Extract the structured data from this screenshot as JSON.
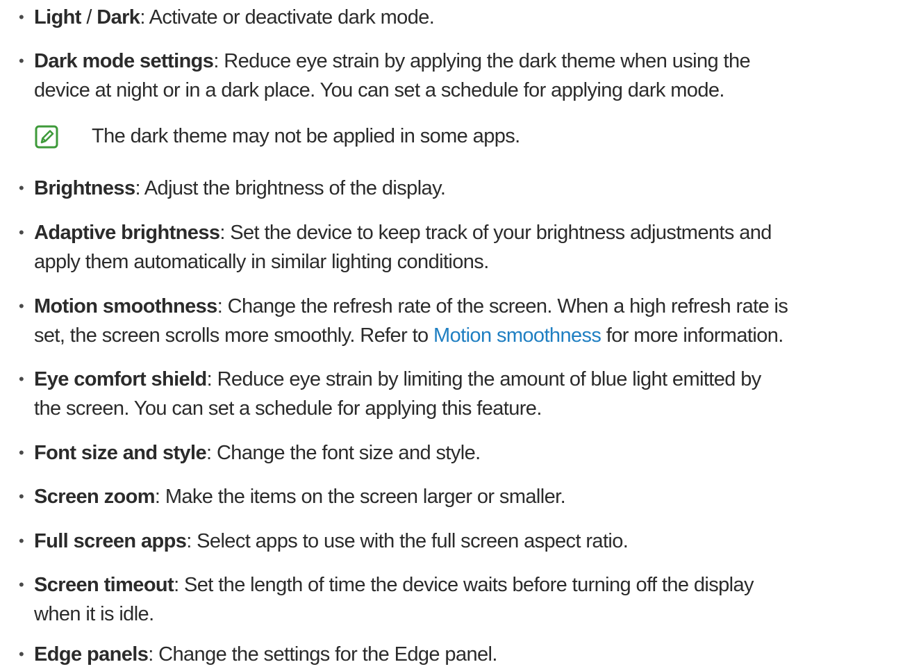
{
  "bullet_char": "•",
  "colors": {
    "text": "#2b2b2b",
    "link": "#1f7fc2",
    "note_icon": "#3e9a3a"
  },
  "items": [
    {
      "lines": [
        {
          "parts": [
            {
              "t": "Light",
              "s": "bold"
            },
            {
              "t": " / "
            },
            {
              "t": "Dark",
              "s": "bold"
            },
            {
              "t": ": Activate or deactivate dark mode."
            }
          ]
        }
      ]
    },
    {
      "lines": [
        {
          "parts": [
            {
              "t": "Dark mode settings",
              "s": "bold"
            },
            {
              "t": ": Reduce eye strain by applying the dark theme when using the"
            }
          ]
        },
        {
          "parts": [
            {
              "t": "device at night or in a dark place. You can set a schedule for applying dark mode."
            }
          ]
        }
      ]
    },
    {
      "lines": [
        {
          "parts": [
            {
              "t": "Brightness",
              "s": "bold"
            },
            {
              "t": ": Adjust the brightness of the display."
            }
          ]
        }
      ]
    },
    {
      "lines": [
        {
          "parts": [
            {
              "t": "Adaptive brightness",
              "s": "bold"
            },
            {
              "t": ": Set the device to keep track of your brightness adjustments and"
            }
          ]
        },
        {
          "parts": [
            {
              "t": "apply them automatically in similar lighting conditions."
            }
          ]
        }
      ]
    },
    {
      "lines": [
        {
          "parts": [
            {
              "t": "Motion smoothness",
              "s": "bold"
            },
            {
              "t": ": Change the refresh rate of the screen. When a high refresh rate is"
            }
          ]
        },
        {
          "parts": [
            {
              "t": "set, the screen scrolls more smoothly. Refer to "
            },
            {
              "t": "Motion smoothness",
              "s": "link"
            },
            {
              "t": " for more information."
            }
          ]
        }
      ]
    },
    {
      "lines": [
        {
          "parts": [
            {
              "t": "Eye comfort shield",
              "s": "bold"
            },
            {
              "t": ": Reduce eye strain by limiting the amount of blue light emitted by"
            }
          ]
        },
        {
          "parts": [
            {
              "t": "the screen. You can set a schedule for applying this feature."
            }
          ]
        }
      ]
    },
    {
      "lines": [
        {
          "parts": [
            {
              "t": "Font size and style",
              "s": "bold"
            },
            {
              "t": ": Change the font size and style."
            }
          ]
        }
      ]
    },
    {
      "lines": [
        {
          "parts": [
            {
              "t": "Screen zoom",
              "s": "bold"
            },
            {
              "t": ": Make the items on the screen larger or smaller."
            }
          ]
        }
      ]
    },
    {
      "lines": [
        {
          "parts": [
            {
              "t": "Full screen apps",
              "s": "bold"
            },
            {
              "t": ": Select apps to use with the full screen aspect ratio."
            }
          ]
        }
      ]
    },
    {
      "lines": [
        {
          "parts": [
            {
              "t": "Screen timeout",
              "s": "bold"
            },
            {
              "t": ": Set the length of time the device waits before turning off the display"
            }
          ]
        },
        {
          "parts": [
            {
              "t": "when it is idle."
            }
          ]
        }
      ]
    },
    {
      "lines": [
        {
          "parts": [
            {
              "t": "Edge panels",
              "s": "bold"
            },
            {
              "t": ": Change the settings for the Edge panel."
            }
          ]
        }
      ]
    }
  ],
  "note": {
    "icon": "note-pencil-icon",
    "text": "The dark theme may not be applied in some apps."
  }
}
